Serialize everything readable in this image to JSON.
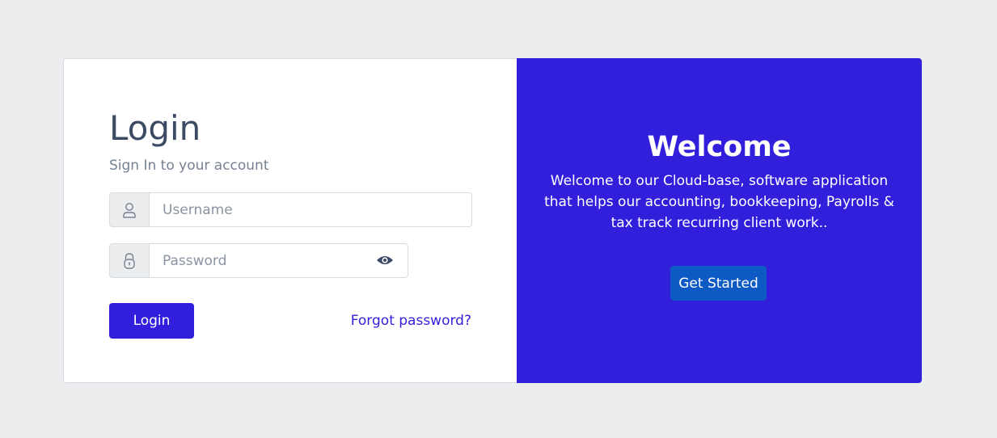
{
  "login": {
    "title": "Login",
    "subtitle": "Sign In to your account",
    "username": {
      "placeholder": "Username",
      "value": "",
      "icon": "user-icon"
    },
    "password": {
      "placeholder": "Password",
      "value": "",
      "icon": "lock-icon",
      "toggle_icon": "eye-icon"
    },
    "login_button": "Login",
    "forgot_link": "Forgot password?"
  },
  "welcome": {
    "title": "Welcome",
    "text": "Welcome to our Cloud-base, software application that helps our accounting, bookkeeping, Payrolls & tax track recurring client work..",
    "button": "Get Started"
  },
  "colors": {
    "background": "#ebedef",
    "primary": "#321fdb",
    "get_started": "#0d5ac4",
    "heading": "#3c4b64",
    "muted": "#768192"
  }
}
